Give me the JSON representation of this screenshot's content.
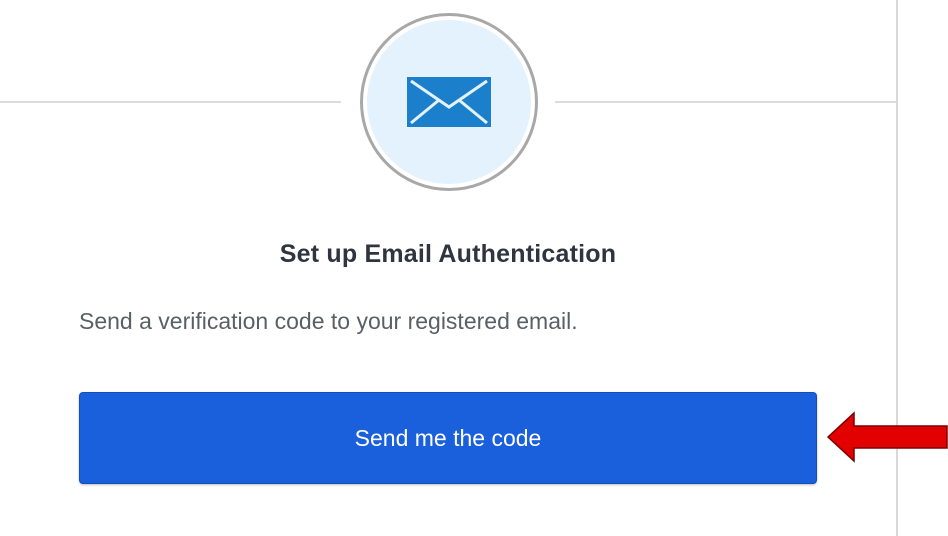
{
  "icons": {
    "factor_icon": "envelope-icon",
    "annotation": "red-arrow-icon"
  },
  "colors": {
    "button_bg": "#1a5fdc",
    "icon_blue": "#1b7fcc",
    "badge_bg": "#e3f2fd",
    "arrow_red": "#e30000"
  },
  "setup": {
    "title": "Set up Email Authentication",
    "description": "Send a verification code to your registered email.",
    "send_button_label": "Send me the code"
  }
}
